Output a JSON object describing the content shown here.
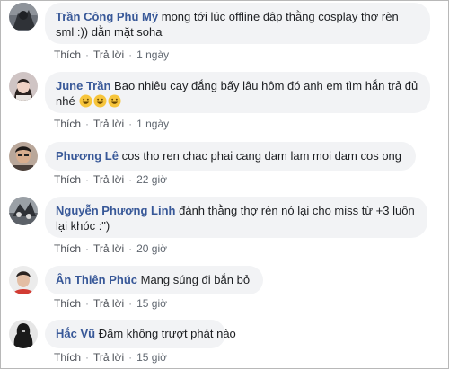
{
  "comments": [
    {
      "author": "Trần Công Phú Mỹ",
      "text": "mong tới lúc offline đập thằng cosplay thợ rèn sml :)) dằn mặt soha",
      "like": "Thích",
      "reply": "Trả lời",
      "time": "1 ngày"
    },
    {
      "author": "June Trần",
      "text": "Bao nhiêu cay đắng bấy lâu hôm đó anh em tìm hắn trả đủ nhé",
      "emoji": [
        "grinning-face-emoji",
        "grinning-face-emoji",
        "grinning-face-emoji"
      ],
      "like": "Thích",
      "reply": "Trả lời",
      "time": "1 ngày"
    },
    {
      "author": "Phương Lê",
      "text": "cos tho ren chac phai cang dam lam moi dam cos ong",
      "like": "Thích",
      "reply": "Trả lời",
      "time": "22 giờ"
    },
    {
      "author": "Nguyễn Phương Linh",
      "text": "đánh thằng thợ rèn nó lại cho miss từ +3 luôn lại khóc :\")",
      "like": "Thích",
      "reply": "Trả lời",
      "time": "20 giờ"
    },
    {
      "author": "Ân Thiên Phúc",
      "text": "Mang súng đi bắn bỏ",
      "like": "Thích",
      "reply": "Trả lời",
      "time": "15 giờ"
    },
    {
      "author": "Hắc Vũ",
      "text": "Đấm không trượt phát nào",
      "like": "Thích",
      "reply": "Trả lời",
      "time": "15 giờ"
    }
  ],
  "separator": "·",
  "colors": {
    "author": "#385898",
    "bubble": "#f2f3f5",
    "meta": "#606770"
  }
}
